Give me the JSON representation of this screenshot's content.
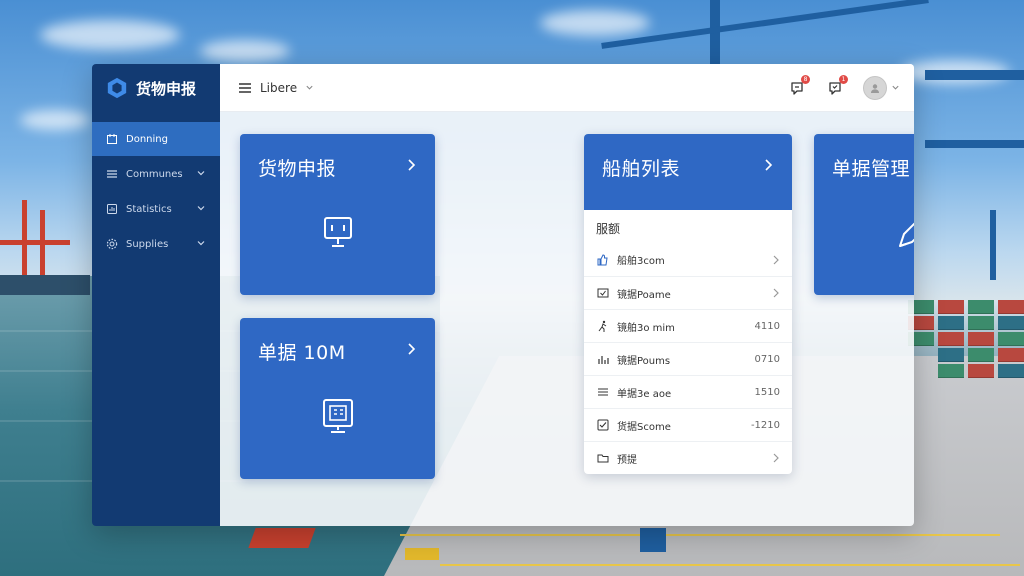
{
  "colors": {
    "sidebar_bg": "#123a72",
    "sidebar_active": "#2e6dc0",
    "card_blue": "#2f68c4",
    "badge_red": "#e14b47"
  },
  "sidebar": {
    "brand": "货物申报",
    "brand_icon": "hexagon-logo-icon",
    "items": [
      {
        "label": "Donning",
        "icon": "document-icon",
        "active": true
      },
      {
        "label": "Communes",
        "icon": "layers-icon",
        "active": false
      },
      {
        "label": "Statistics",
        "icon": "chart-icon",
        "active": false
      },
      {
        "label": "Supplies",
        "icon": "gear-icon",
        "active": false
      }
    ]
  },
  "topbar": {
    "menu_label": "Libere",
    "notifications": [
      {
        "icon": "bell-icon",
        "badge": "8"
      },
      {
        "icon": "chat-icon",
        "badge": "1"
      }
    ],
    "avatar_icon": "user-avatar-icon"
  },
  "cards": [
    {
      "title": "货物申报",
      "icon": "monitor-icon"
    },
    {
      "title": "单据管理",
      "icon": "edit-pen-icon"
    },
    {
      "title": "单据 10M",
      "icon": "screen-icon"
    }
  ],
  "ship_list": {
    "title": "船舶列表",
    "section": "服额",
    "rows": [
      {
        "icon": "thumb-icon",
        "label": "船舶3com",
        "value": "",
        "chevron": true
      },
      {
        "icon": "check-box-icon",
        "label": "镜据Poame",
        "value": "",
        "chevron": true
      },
      {
        "icon": "person-run-icon",
        "label": "镜舶3o mim",
        "value": "4110",
        "chevron": false
      },
      {
        "icon": "bar-chart-icon",
        "label": "镜据Poums",
        "value": "0710",
        "chevron": false
      },
      {
        "icon": "list-icon",
        "label": "单据3e aoe",
        "value": "1510",
        "chevron": false
      },
      {
        "icon": "checkbox-done-icon",
        "label": "货据Scome",
        "value": "-1210",
        "chevron": false
      },
      {
        "icon": "folder-icon",
        "label": "预提",
        "value": "",
        "chevron": true
      }
    ]
  }
}
